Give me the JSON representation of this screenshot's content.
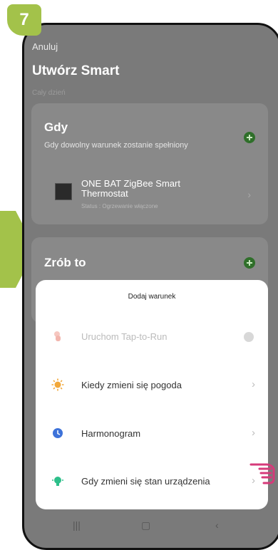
{
  "step_badge": "7",
  "header": {
    "cancel_label": "Anuluj",
    "title": "Utwórz Smart",
    "subtitle": "Cały dzień"
  },
  "when_card": {
    "heading": "Gdy",
    "description": "Gdy dowolny warunek zostanie spełniony",
    "device": {
      "name": "ONE BAT ZigBee Smart Thermostat",
      "status": "Status : Ogrzewanie włączone"
    }
  },
  "do_card": {
    "heading": "Zrób to"
  },
  "sheet": {
    "title": "Dodaj warunek",
    "options": [
      {
        "label": "Uruchom Tap-to-Run",
        "icon": "hand-tap-icon",
        "enabled": false
      },
      {
        "label": "Kiedy zmieni się pogoda",
        "icon": "sun-icon",
        "enabled": true
      },
      {
        "label": "Harmonogram",
        "icon": "clock-icon",
        "enabled": true
      },
      {
        "label": "Gdy zmieni się stan urządzenia",
        "icon": "device-state-icon",
        "enabled": true
      }
    ]
  },
  "colors": {
    "badge": "#a3c24a",
    "accent_green": "#2f6f2a",
    "sun": "#f2a83a",
    "clock": "#3d72d9",
    "device": "#2dbf8a",
    "pointer": "#d63a7a"
  }
}
